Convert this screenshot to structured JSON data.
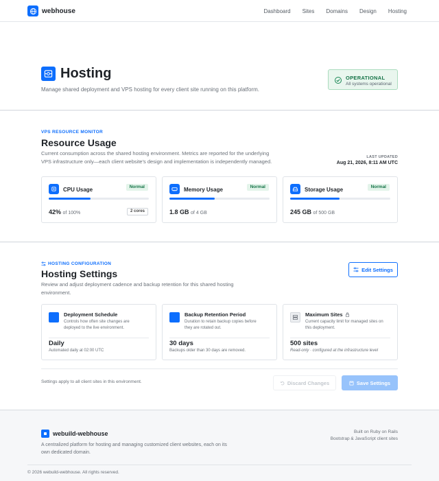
{
  "navbar": {
    "brand": "webhouse",
    "links": [
      "Dashboard",
      "Sites",
      "Domains",
      "Design",
      "Hosting"
    ]
  },
  "hero": {
    "title": "Hosting",
    "subtitle": "Manage shared deployment and VPS hosting for every client site running on this platform.",
    "status": {
      "title": "OPERATIONAL",
      "description": "All systems operational",
      "color": "#198754"
    }
  },
  "resources": {
    "eyebrow": "VPS RESOURCE MONITOR",
    "title": "Resource Usage",
    "description_line1": "Current consumption across the shared hosting environment. Metrics are reported for the underlying",
    "description_line2": "VPS infrastructure only—each client website's design and implementation is independently managed.",
    "updated_label": "LAST UPDATED",
    "updated_value": "Aug 21, 2026, 8:11 AM UTC",
    "metrics": [
      {
        "name": "CPU Usage",
        "badge": "Normal",
        "value": "42%",
        "unit": "of 100%",
        "chip": "2 cores",
        "fill": 0.42,
        "icon": "cpu-icon"
      },
      {
        "name": "Memory Usage",
        "badge": "Normal",
        "value": "1.8 GB",
        "unit": "of 4 GB",
        "chip": "",
        "fill": 0.45,
        "icon": "memory-icon"
      },
      {
        "name": "Storage Usage",
        "badge": "Normal",
        "value": "245 GB",
        "unit": "of 500 GB",
        "chip": "",
        "fill": 0.49,
        "icon": "storage-icon"
      }
    ],
    "accent": "#0d6efd"
  },
  "settings": {
    "eyebrow": "HOSTING CONFIGURATION",
    "title": "Hosting Settings",
    "description_line1": "Review and adjust deployment cadence and backup retention for this shared hosting",
    "description_line2": "environment.",
    "edit_label": "Edit Settings",
    "cards": [
      {
        "name": "Deployment Schedule",
        "desc_line1": "Controls how often site changes are",
        "desc_line2": "deployed to the live environment.",
        "value": "Daily",
        "note": "Automated daily at 02:00 UTC"
      },
      {
        "name": "Backup Retention Period",
        "desc_line1": "Duration to retain backup copies before",
        "desc_line2": "they are rotated out.",
        "value": "30 days",
        "note": "Backups older than 30 days are removed."
      },
      {
        "name": "Maximum Sites",
        "desc_line1": "Current capacity limit for managed sites on",
        "desc_line2": "this deployment.",
        "value": "500 sites",
        "note": "Read-only · configured at the infrastructure level"
      }
    ],
    "footnote": "Settings apply to all client sites in this environment.",
    "discard_label": "Discard Changes",
    "save_label": "Save Settings"
  },
  "footer": {
    "name": "webuild-webhouse",
    "desc_line1": "A centralized platform for hosting and managing customized client websites, each on its",
    "desc_line2": "own dedicated domain.",
    "built_on": "Built on Ruby on Rails",
    "stack": "Bootstrap & JavaScript client sites",
    "copyright": "© 2026 webuild-webhouse. All rights reserved."
  }
}
